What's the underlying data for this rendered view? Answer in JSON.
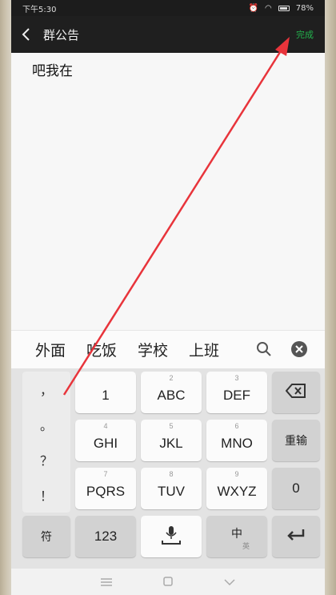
{
  "status_bar": {
    "time": "下午5:30",
    "battery": "78%"
  },
  "header": {
    "title": "群公告",
    "done_label": "完成"
  },
  "editor": {
    "text": "吧我在"
  },
  "candidates": [
    "外面",
    "吃饭",
    "学校",
    "上班"
  ],
  "keyboard": {
    "punctuation": [
      "，",
      "。",
      "？",
      "！"
    ],
    "rows": [
      [
        {
          "num": "",
          "label": "1"
        },
        {
          "num": "2",
          "label": "ABC"
        },
        {
          "num": "3",
          "label": "DEF"
        }
      ],
      [
        {
          "num": "4",
          "label": "GHI"
        },
        {
          "num": "5",
          "label": "JKL"
        },
        {
          "num": "6",
          "label": "MNO"
        }
      ],
      [
        {
          "num": "7",
          "label": "PQRS"
        },
        {
          "num": "8",
          "label": "TUV"
        },
        {
          "num": "9",
          "label": "WXYZ"
        }
      ]
    ],
    "side_keys": {
      "retype": "重输",
      "zero": "0"
    },
    "bottom": {
      "symbol": "符",
      "numeric": "123",
      "lang": "中",
      "lang_sub": "英"
    }
  },
  "colors": {
    "accent": "#22b14c",
    "annotation_arrow": "#e8343b"
  },
  "icons": [
    "back-icon",
    "search-icon",
    "close-circle-icon",
    "backspace-icon",
    "microphone-icon",
    "enter-icon",
    "menu-icon",
    "home-icon",
    "down-chevron-icon"
  ]
}
